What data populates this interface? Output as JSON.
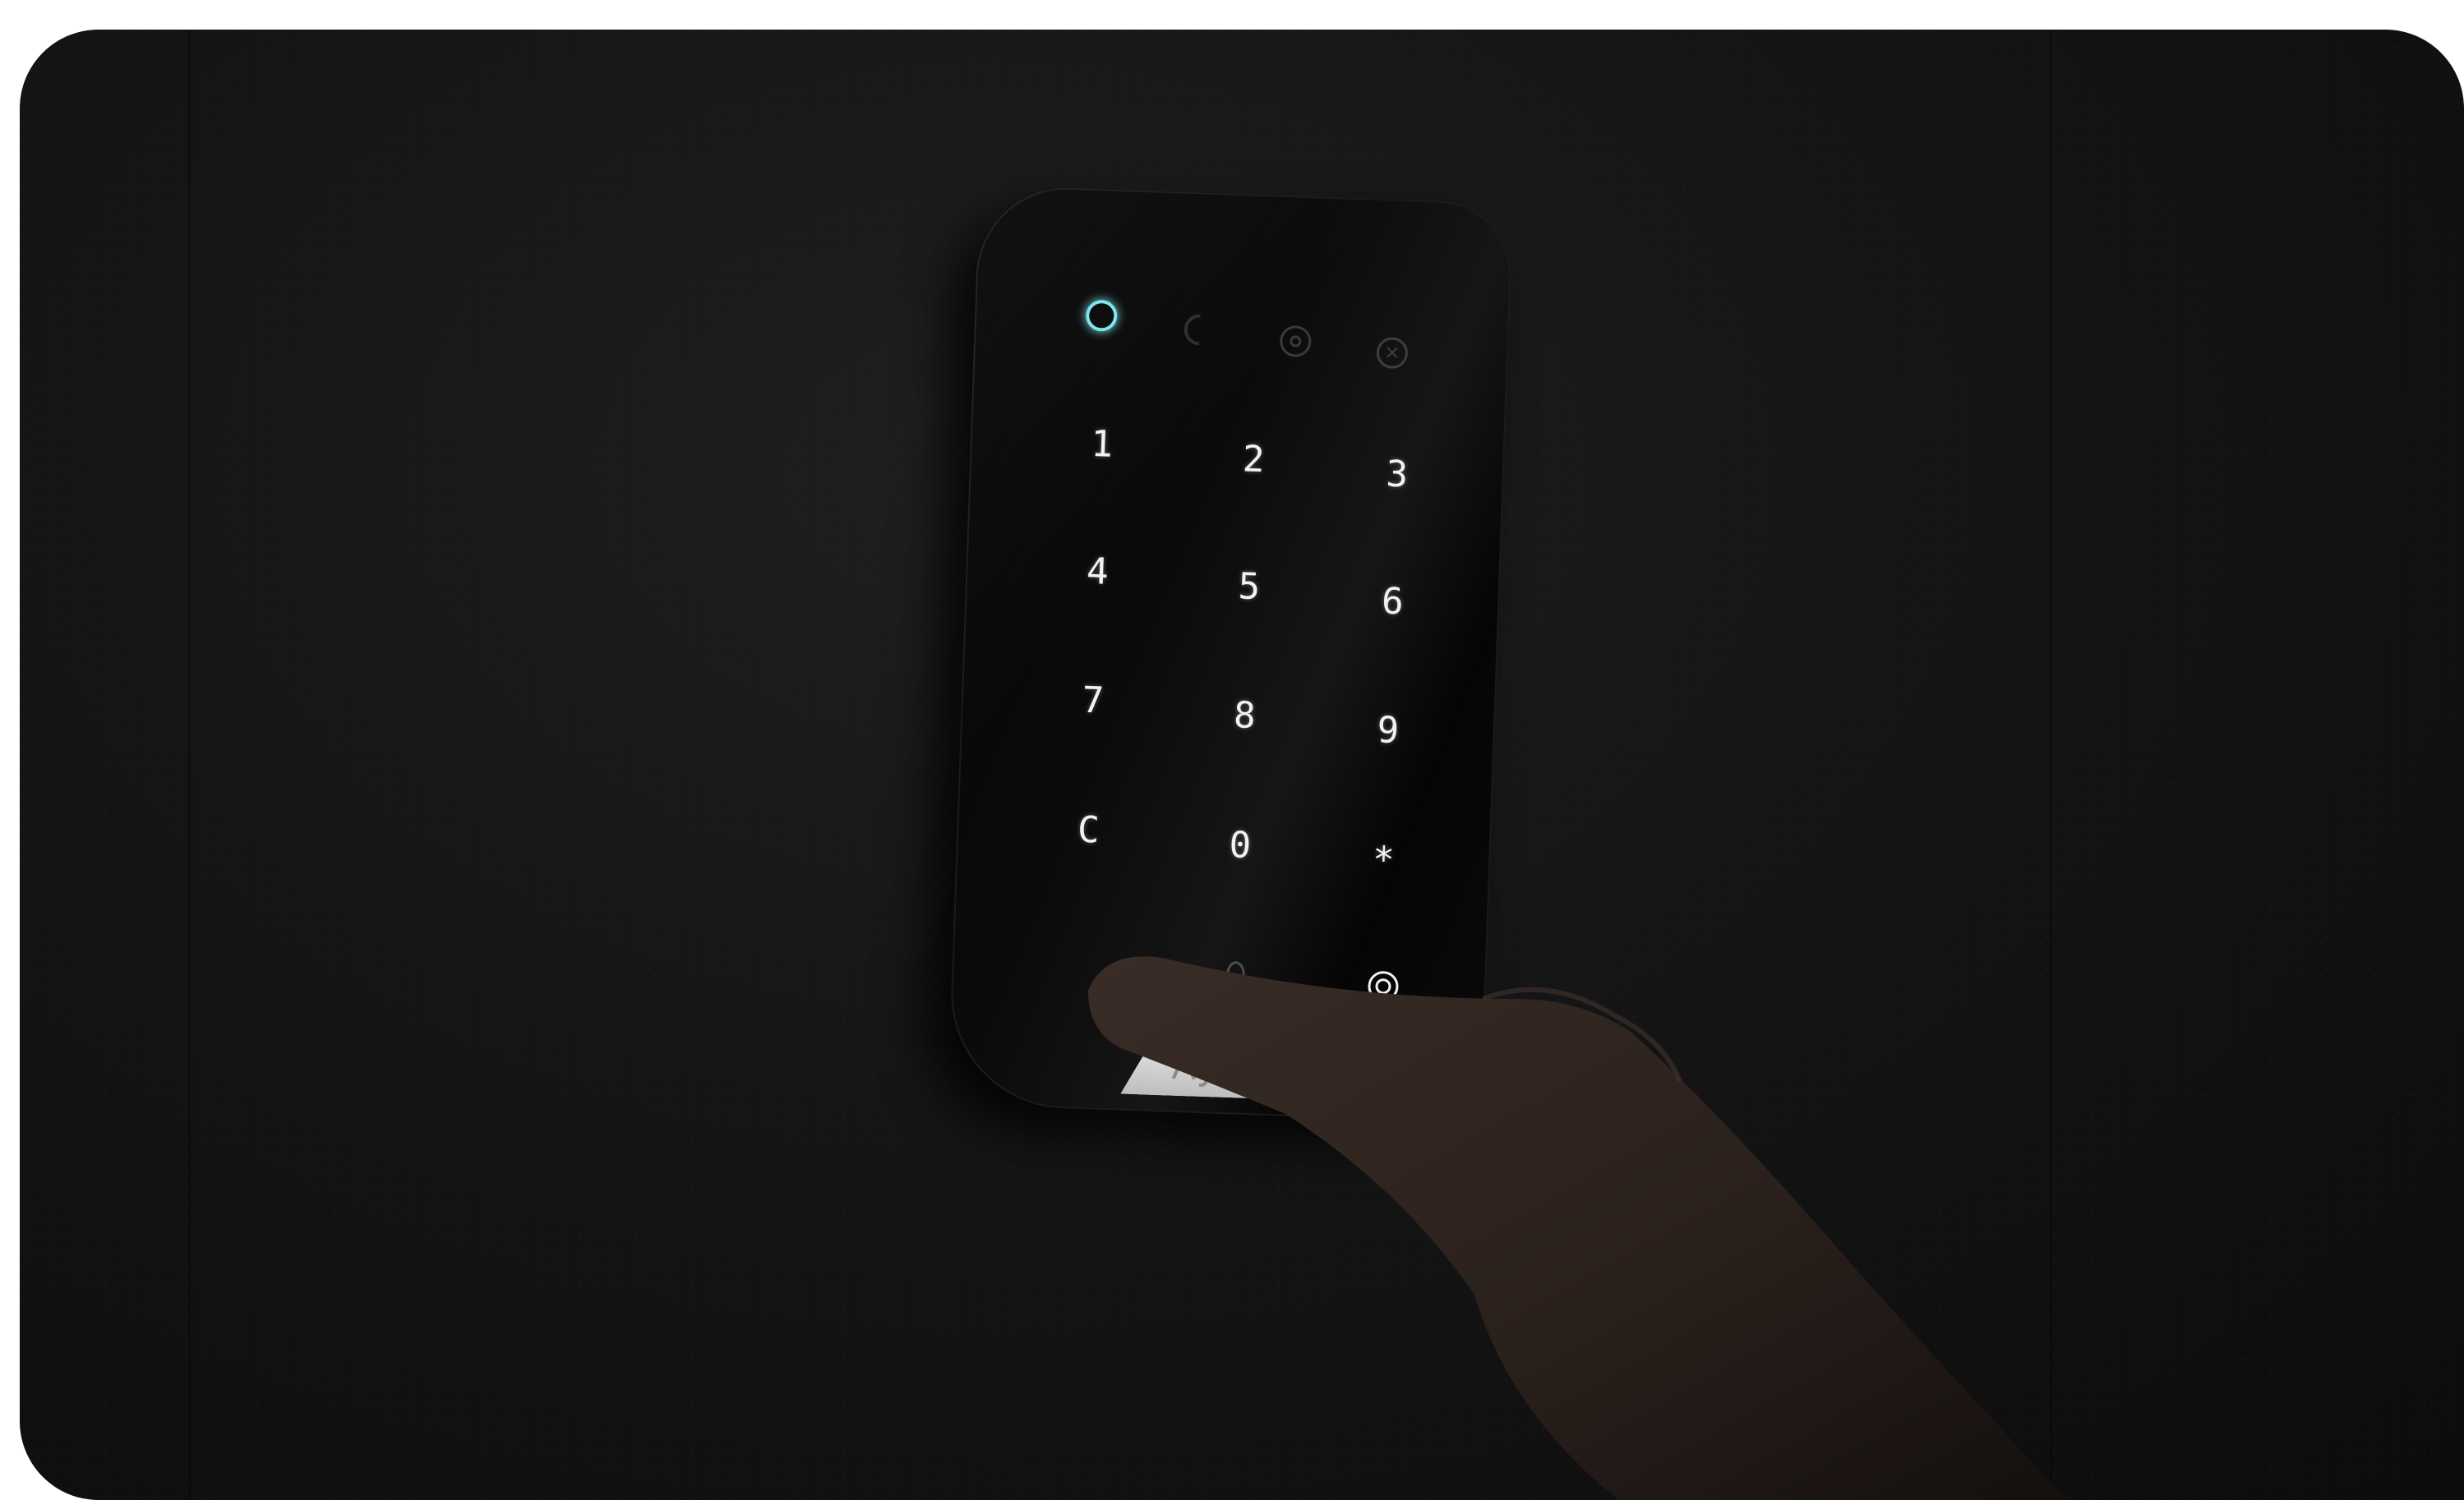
{
  "scene": {
    "accent_color": "#7fe6ee",
    "key_color": "#f2f2f2",
    "background_color": "#151515"
  },
  "keypad": {
    "indicators": [
      "ring-icon",
      "moon-icon",
      "target-icon",
      "cross-circle-icon"
    ],
    "rows": [
      [
        "1",
        "2",
        "3"
      ],
      [
        "4",
        "5",
        "6"
      ],
      [
        "7",
        "8",
        "9"
      ],
      [
        "C",
        "0",
        "*"
      ]
    ],
    "bottom_keys": [
      "bell-icon",
      "shield-check-icon"
    ],
    "brand": "AJAX"
  }
}
